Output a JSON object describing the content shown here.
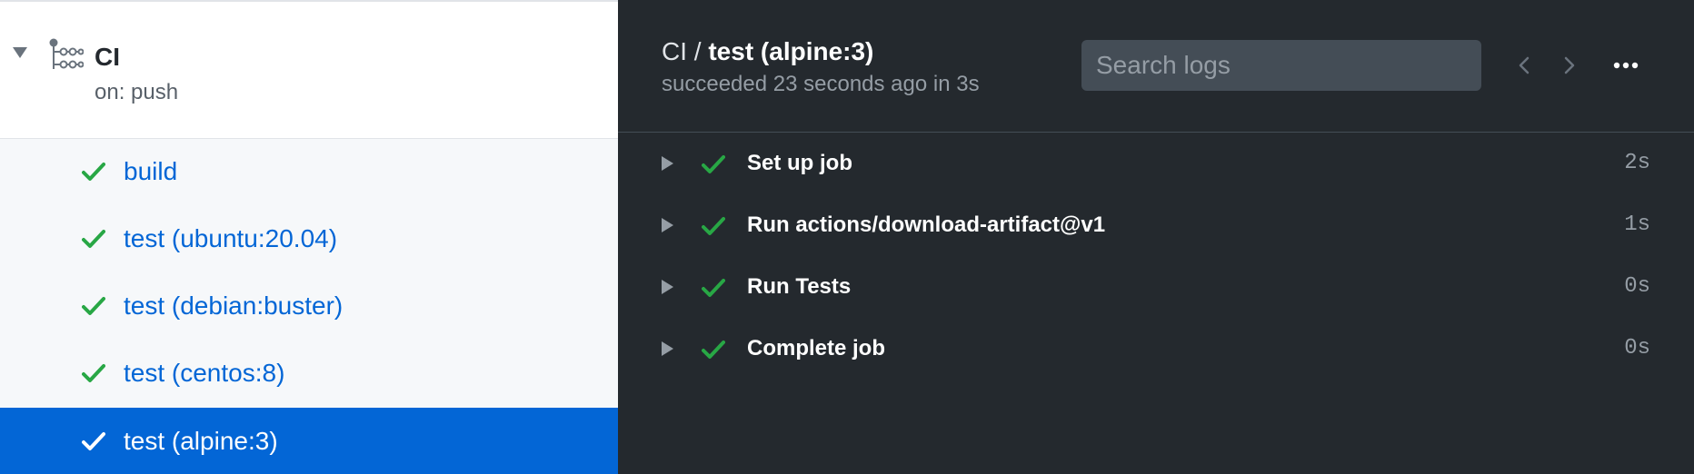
{
  "colors": {
    "success": "#28a745",
    "link": "#0366d6",
    "selected_bg": "#0366d6",
    "panel_bg": "#24292e"
  },
  "workflow": {
    "name": "CI",
    "trigger": "on: push",
    "icon": "workflow-icon"
  },
  "jobs": [
    {
      "label": "build",
      "status": "success"
    },
    {
      "label": "test (ubuntu:20.04)",
      "status": "success"
    },
    {
      "label": "test (debian:buster)",
      "status": "success"
    },
    {
      "label": "test (centos:8)",
      "status": "success"
    },
    {
      "label": "test (alpine:3)",
      "status": "success",
      "selected": true
    }
  ],
  "log_header": {
    "workflow_crumb": "CI",
    "separator": " / ",
    "job_crumb": "test (alpine:3)",
    "status_text": "succeeded 23 seconds ago in 3s"
  },
  "search": {
    "placeholder": "Search logs",
    "value": ""
  },
  "steps": [
    {
      "name": "Set up job",
      "duration": "2s",
      "status": "success"
    },
    {
      "name": "Run actions/download-artifact@v1",
      "duration": "1s",
      "status": "success"
    },
    {
      "name": "Run Tests",
      "duration": "0s",
      "status": "success"
    },
    {
      "name": "Complete job",
      "duration": "0s",
      "status": "success"
    }
  ]
}
